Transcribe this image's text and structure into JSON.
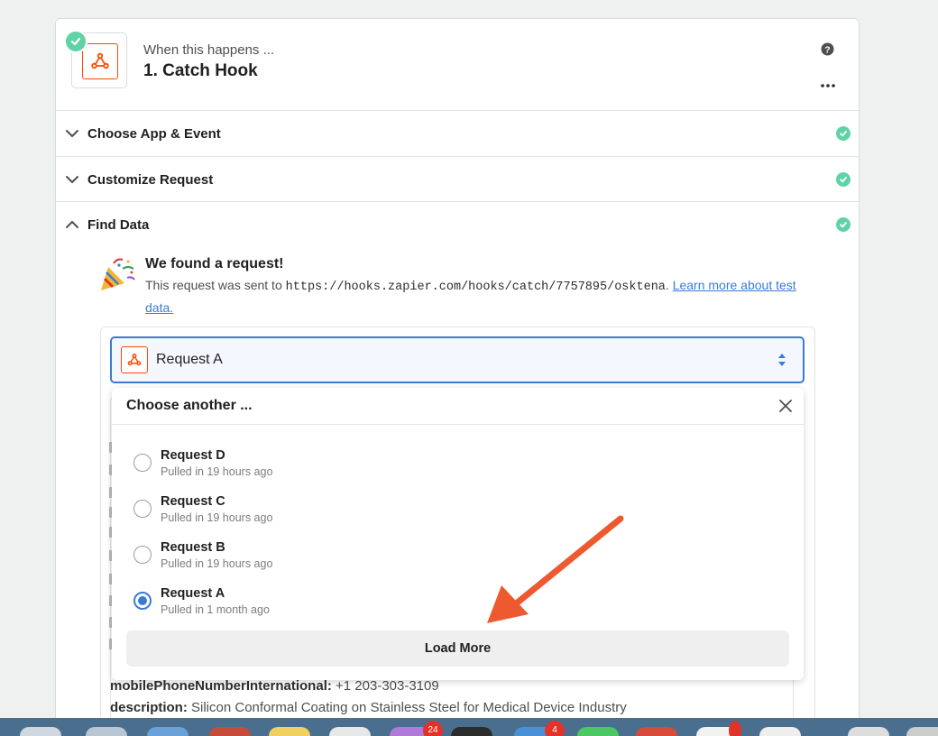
{
  "step": {
    "when_label": "When this happens ...",
    "title": "1. Catch Hook"
  },
  "sections": [
    {
      "label": "Choose App & Event",
      "status": "complete"
    },
    {
      "label": "Customize Request",
      "status": "complete"
    },
    {
      "label": "Find Data",
      "status": "complete",
      "expanded": true
    }
  ],
  "found": {
    "title": "We found a request!",
    "text_prefix": "This request was sent to",
    "url": "https://hooks.zapier.com/hooks/catch/7757895/osktena",
    "text_suffix": ".",
    "link": "Learn more about test data."
  },
  "select": {
    "value": "Request A"
  },
  "dropdown": {
    "title": "Choose another ...",
    "options": [
      {
        "name": "Request D",
        "sub": "Pulled in 19 hours ago",
        "selected": false
      },
      {
        "name": "Request C",
        "sub": "Pulled in 19 hours ago",
        "selected": false
      },
      {
        "name": "Request B",
        "sub": "Pulled in 19 hours ago",
        "selected": false
      },
      {
        "name": "Request A",
        "sub": "Pulled in 1 month ago",
        "selected": true
      }
    ],
    "load_more": "Load More"
  },
  "fields": [
    {
      "key": "mobilePhoneNumberInternational:",
      "value": "+1 203-303-3109"
    },
    {
      "key": "description:",
      "value": "Silicon Conformal Coating on Stainless Steel for Medical Device Industry"
    }
  ],
  "dock": {
    "badges": [
      "24",
      "4"
    ]
  },
  "colors": {
    "accent": "#3b7bd4",
    "success": "#5fd3a6",
    "brand": "#ff4a00",
    "arrow": "#ee5a2f"
  }
}
